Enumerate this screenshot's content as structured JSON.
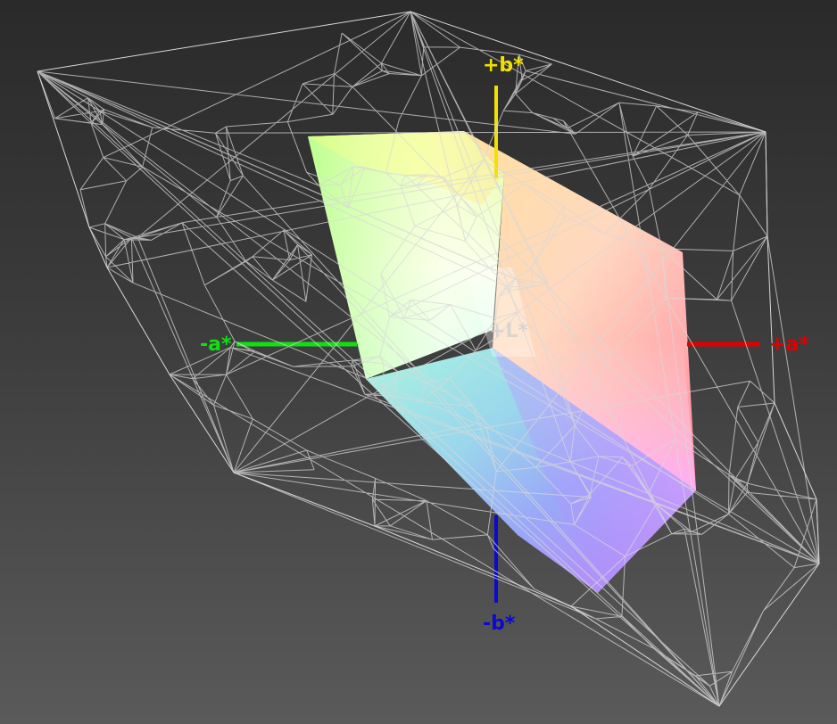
{
  "axes": {
    "plus_b": "+b*",
    "minus_b": "-b*",
    "plus_a": "+a*",
    "minus_a": "-a*",
    "plus_L": "+L*"
  },
  "colors": {
    "background_top": "#2a2a2a",
    "background_bottom": "#5a5a5a",
    "wireframe": "#d8d8d8",
    "axis_plus_b": "#f2e000",
    "axis_minus_b": "#0a0ad0",
    "axis_plus_a": "#e00000",
    "axis_minus_a": "#10e010",
    "axis_L": "#d0d0d0"
  }
}
